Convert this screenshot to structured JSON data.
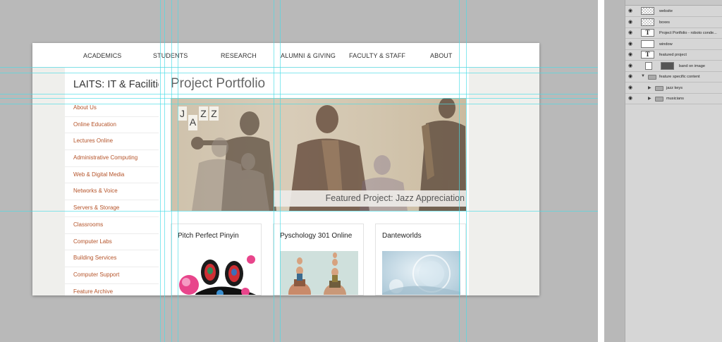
{
  "website": {
    "top_nav": [
      "ACADEMICS",
      "STUDENTS",
      "RESEARCH",
      "ALUMNI & GIVING",
      "FACULTY & STAFF",
      "ABOUT"
    ],
    "site_title": "LAITS: IT & Facilities",
    "side_nav": [
      "About Us",
      "Online Education",
      "Lectures Online",
      "Administrative Computing",
      "Web & Digital Media",
      "Networks & Voice",
      "Servers & Storage",
      "Classrooms",
      "Computer Labs",
      "Building Services",
      "Computer Support",
      "Feature Archive"
    ],
    "page_title": "Project Portfolio",
    "featured": {
      "logo_letters": [
        "J",
        "A",
        "Z",
        "Z"
      ],
      "caption": "Featured Project: Jazz Appreciation"
    },
    "cards": [
      {
        "title": "Pitch Perfect Pinyin"
      },
      {
        "title": "Pyschology 301 Online"
      },
      {
        "title": "Danteworlds"
      }
    ]
  },
  "layers_panel": {
    "layers": [
      {
        "name": "website",
        "thumb": "checker",
        "indent": 0
      },
      {
        "name": "boxes",
        "thumb": "checker",
        "indent": 0
      },
      {
        "name": "Project Portfolio - roboto conde...",
        "thumb": "text",
        "indent": 0
      },
      {
        "name": "window",
        "thumb": "white",
        "indent": 0
      },
      {
        "name": "featured project",
        "thumb": "text",
        "indent": 0
      },
      {
        "name": "band on image",
        "thumb": "mask",
        "indent": 0
      },
      {
        "name": "feature specific content",
        "thumb": "folder",
        "indent": 0
      },
      {
        "name": "jazz keys",
        "thumb": "folder",
        "indent": 1
      },
      {
        "name": "musicians",
        "thumb": "folder",
        "indent": 1
      }
    ]
  },
  "colors": {
    "link_orange": "#b5542a",
    "guide_cyan": "#46dce6",
    "canvas_gray": "#b9b9b9"
  }
}
